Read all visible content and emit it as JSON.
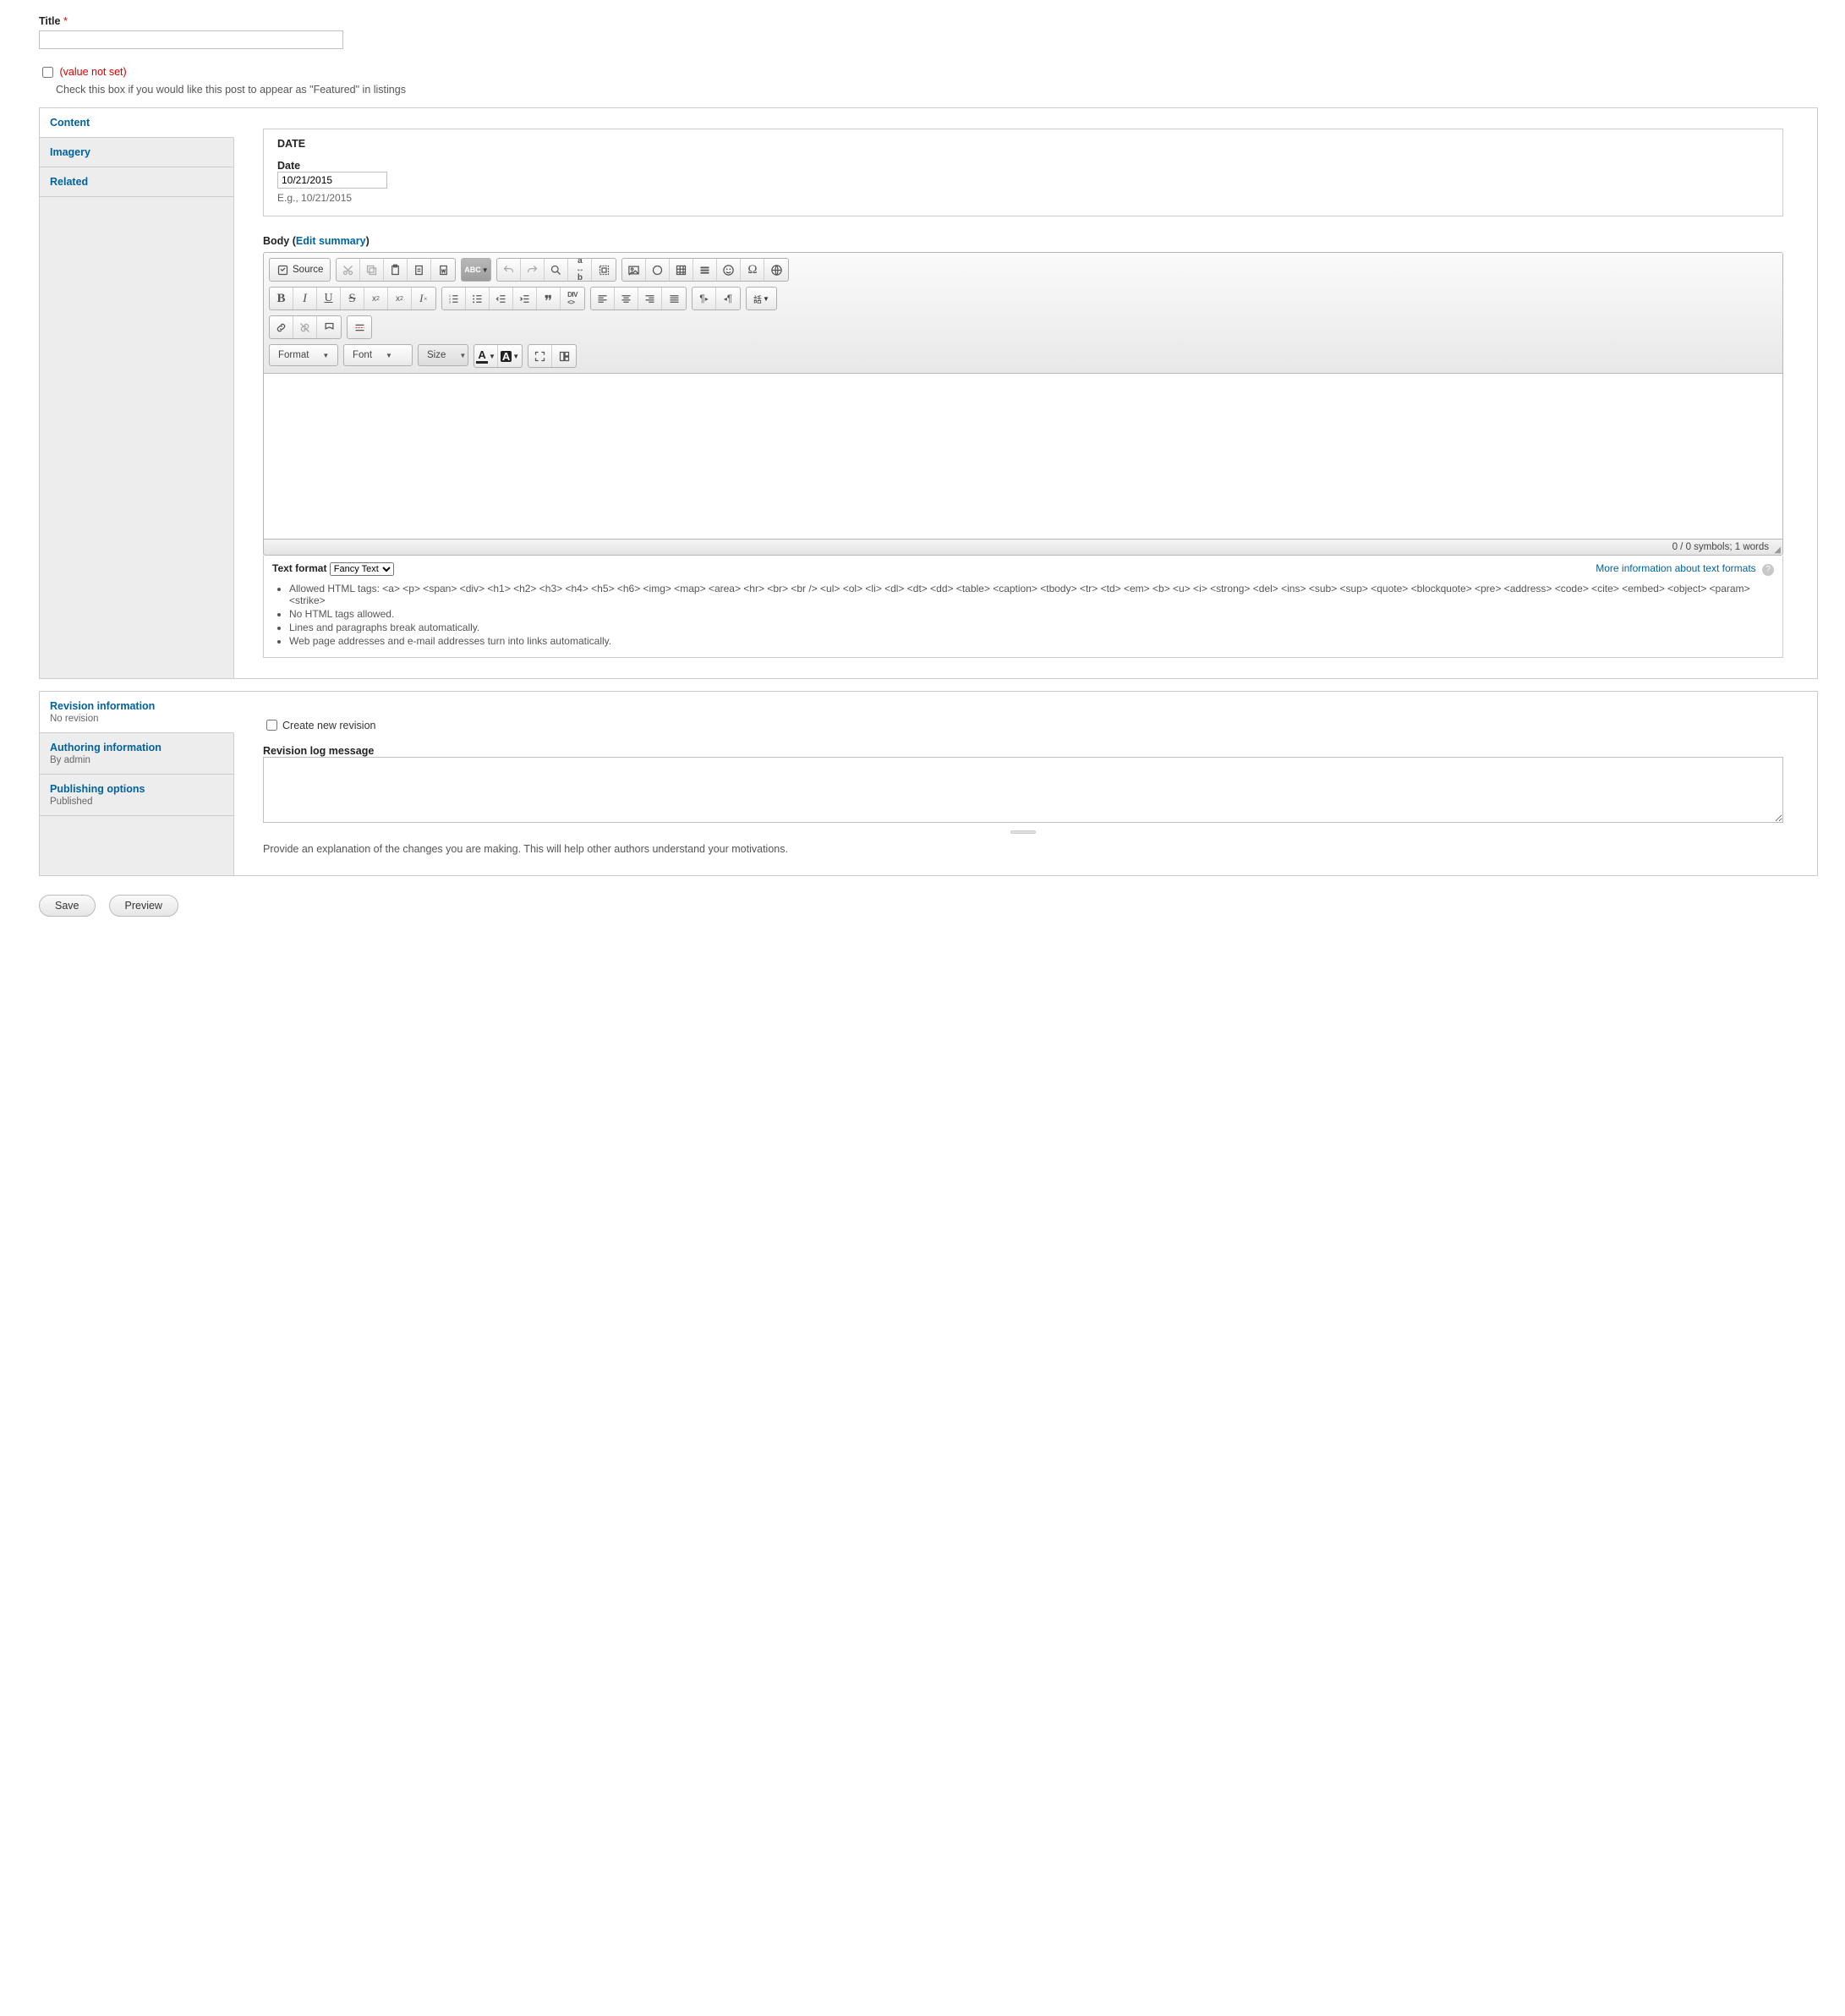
{
  "title": {
    "label": "Title",
    "value": ""
  },
  "featured": {
    "checkbox_label": "(value not set)",
    "help": "Check this box if you would like this post to appear as \"Featured\" in listings"
  },
  "tabs_primary": [
    {
      "label": "Content",
      "active": true
    },
    {
      "label": "Imagery",
      "active": false
    },
    {
      "label": "Related",
      "active": false
    }
  ],
  "date": {
    "fieldset_legend": "DATE",
    "label": "Date",
    "value": "10/21/2015",
    "example": "E.g., 10/21/2015"
  },
  "body": {
    "label_prefix": "Body (",
    "edit_summary": "Edit summary",
    "label_suffix": ")",
    "source_btn": "Source",
    "abc_btn": "ABC",
    "format_dd": "Format",
    "font_dd": "Font",
    "size_dd": "Size",
    "footer": "0 / 0 symbols; 1 words"
  },
  "text_format": {
    "label": "Text format",
    "selected": "Fancy Text",
    "more_link": "More information about text formats",
    "help": [
      "Allowed HTML tags: <a> <p> <span> <div> <h1> <h2> <h3> <h4> <h5> <h6> <img> <map> <area> <hr> <br> <br /> <ul> <ol> <li> <dl> <dt> <dd> <table> <caption> <tbody> <tr> <td> <em> <b> <u> <i> <strong> <del> <ins> <sub> <sup> <quote> <blockquote> <pre> <address> <code> <cite> <embed> <object> <param> <strike>",
      "No HTML tags allowed.",
      "Lines and paragraphs break automatically.",
      "Web page addresses and e-mail addresses turn into links automatically."
    ]
  },
  "tabs_secondary": [
    {
      "label": "Revision information",
      "sub": "No revision",
      "active": true
    },
    {
      "label": "Authoring information",
      "sub": "By admin",
      "active": false
    },
    {
      "label": "Publishing options",
      "sub": "Published",
      "active": false
    }
  ],
  "revision": {
    "create_label": "Create new revision",
    "log_label": "Revision log message",
    "log_value": "",
    "help": "Provide an explanation of the changes you are making. This will help other authors understand your motivations."
  },
  "actions": {
    "save": "Save",
    "preview": "Preview"
  }
}
